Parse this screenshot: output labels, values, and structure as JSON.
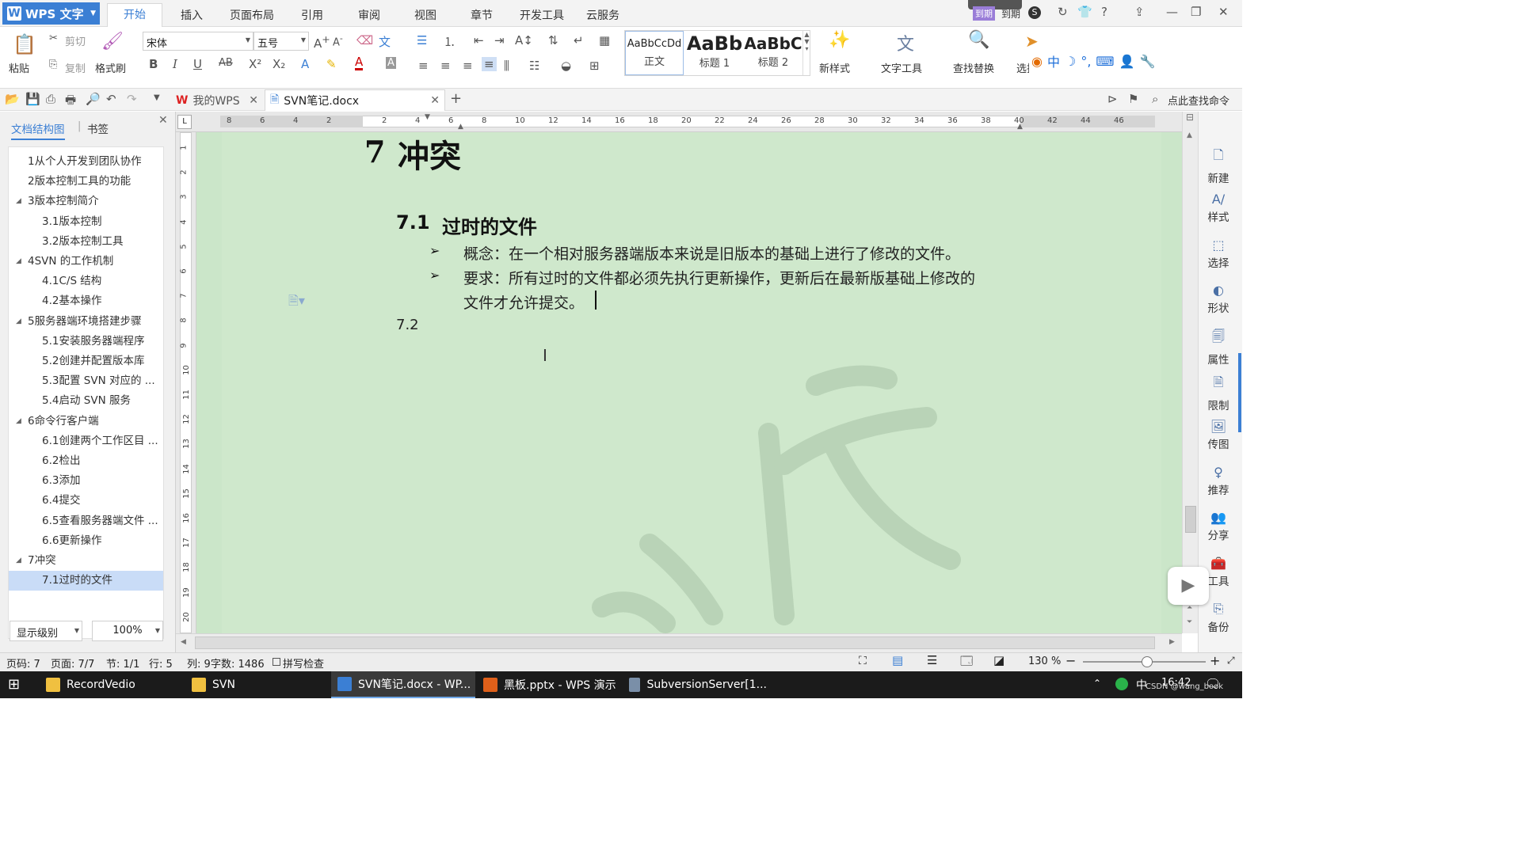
{
  "app": {
    "title": "WPS 文字"
  },
  "menu": {
    "items": [
      "开始",
      "插入",
      "页面布局",
      "引用",
      "审阅",
      "视图",
      "章节",
      "开发工具",
      "云服务"
    ],
    "right_user": "到期"
  },
  "ribbon": {
    "paste": "粘贴",
    "cut": "剪切",
    "copy": "复制",
    "format_painter": "格式刷",
    "font_name": "宋体",
    "font_size": "五号",
    "styles": [
      {
        "sample": "AaBbCcDd",
        "label": "正文"
      },
      {
        "sample": "AaBb",
        "label": "标题 1"
      },
      {
        "sample": "AaBbC",
        "label": "标题 2"
      }
    ],
    "new_style": "新样式",
    "text_tool": "文字工具",
    "find_replace": "查找替换",
    "select": "选择"
  },
  "quickbar": {
    "tabs": [
      {
        "label": "我的WPS"
      },
      {
        "label": "SVN笔记.docx"
      }
    ],
    "search_cmd": "点此查找命令"
  },
  "left_panel": {
    "tab_outline": "文档结构图",
    "tab_bookmark": "书签",
    "outline": [
      {
        "text": "1从个人开发到团队协作",
        "level": 1
      },
      {
        "text": "2版本控制工具的功能",
        "level": 1
      },
      {
        "text": "3版本控制简介",
        "level": 1,
        "expanded": true
      },
      {
        "text": "3.1版本控制",
        "level": 2
      },
      {
        "text": "3.2版本控制工具",
        "level": 2
      },
      {
        "text": "4SVN 的工作机制",
        "level": 1,
        "expanded": true
      },
      {
        "text": "4.1C/S 结构",
        "level": 2
      },
      {
        "text": "4.2基本操作",
        "level": 2
      },
      {
        "text": "5服务器端环境搭建步骤",
        "level": 1,
        "expanded": true
      },
      {
        "text": "5.1安装服务器端程序",
        "level": 2
      },
      {
        "text": "5.2创建并配置版本库",
        "level": 2
      },
      {
        "text": "5.3配置 SVN 对应的 ...",
        "level": 2
      },
      {
        "text": "5.4启动 SVN 服务",
        "level": 2
      },
      {
        "text": "6命令行客户端",
        "level": 1,
        "expanded": true
      },
      {
        "text": "6.1创建两个工作区目 ...",
        "level": 2
      },
      {
        "text": "6.2检出",
        "level": 2
      },
      {
        "text": "6.3添加",
        "level": 2
      },
      {
        "text": "6.4提交",
        "level": 2
      },
      {
        "text": "6.5查看服务器端文件 ...",
        "level": 2
      },
      {
        "text": "6.6更新操作",
        "level": 2
      },
      {
        "text": "7冲突",
        "level": 1,
        "expanded": true
      },
      {
        "text": "7.1过时的文件",
        "level": 2,
        "selected": true
      }
    ],
    "show_level": "显示级别",
    "zoom": "100%"
  },
  "ruler": {
    "h_numbers": [
      "8",
      "6",
      "4",
      "2",
      "2",
      "4",
      "6",
      "8",
      "10",
      "12",
      "14",
      "16",
      "18",
      "20",
      "22",
      "24",
      "26",
      "28",
      "30",
      "32",
      "34",
      "36",
      "38",
      "40",
      "42",
      "44",
      "46"
    ],
    "v_numbers": [
      "1",
      "2",
      "3",
      "4",
      "5",
      "6",
      "7",
      "8",
      "9",
      "10",
      "11",
      "12",
      "13",
      "14",
      "15",
      "16",
      "17",
      "18",
      "19",
      "20"
    ]
  },
  "document": {
    "h1_num": "7",
    "h1_text": "冲突",
    "h2_num": "7.1",
    "h2_text": "过时的文件",
    "bullets": [
      "概念：在一个相对服务器端版本来说是旧版本的基础上进行了修改的文件。",
      "要求：所有过时的文件都必须先执行更新操作，更新后在最新版基础上修改的",
      "文件才允许提交。"
    ],
    "h2b": "7.2",
    "watermark": "谷广"
  },
  "sidebar": {
    "items": [
      "新建",
      "样式",
      "选择",
      "形状",
      "属性",
      "限制",
      "传图",
      "推荐",
      "分享",
      "工具",
      "备份"
    ]
  },
  "status": {
    "page_num": "页码: 7",
    "page": "页面: 7/7",
    "section": "节: 1/1",
    "row": "行: 5",
    "col": "列: 9",
    "words": "字数: 1486",
    "spell": "拼写检查",
    "zoom": "130 %"
  },
  "taskbar": {
    "items": [
      {
        "label": "RecordVedio"
      },
      {
        "label": "SVN"
      },
      {
        "label": "SVN笔记.docx - WP..."
      },
      {
        "label": "黑板.pptx - WPS 演示"
      },
      {
        "label": "SubversionServer[1..."
      }
    ],
    "ime": "中",
    "time": "16:42",
    "watermark": "CSDN @wang_book"
  },
  "colors": {
    "accent": "#3b7fd4",
    "doc_bg": "#cfe8cc",
    "selection": "#c9dcf7"
  }
}
